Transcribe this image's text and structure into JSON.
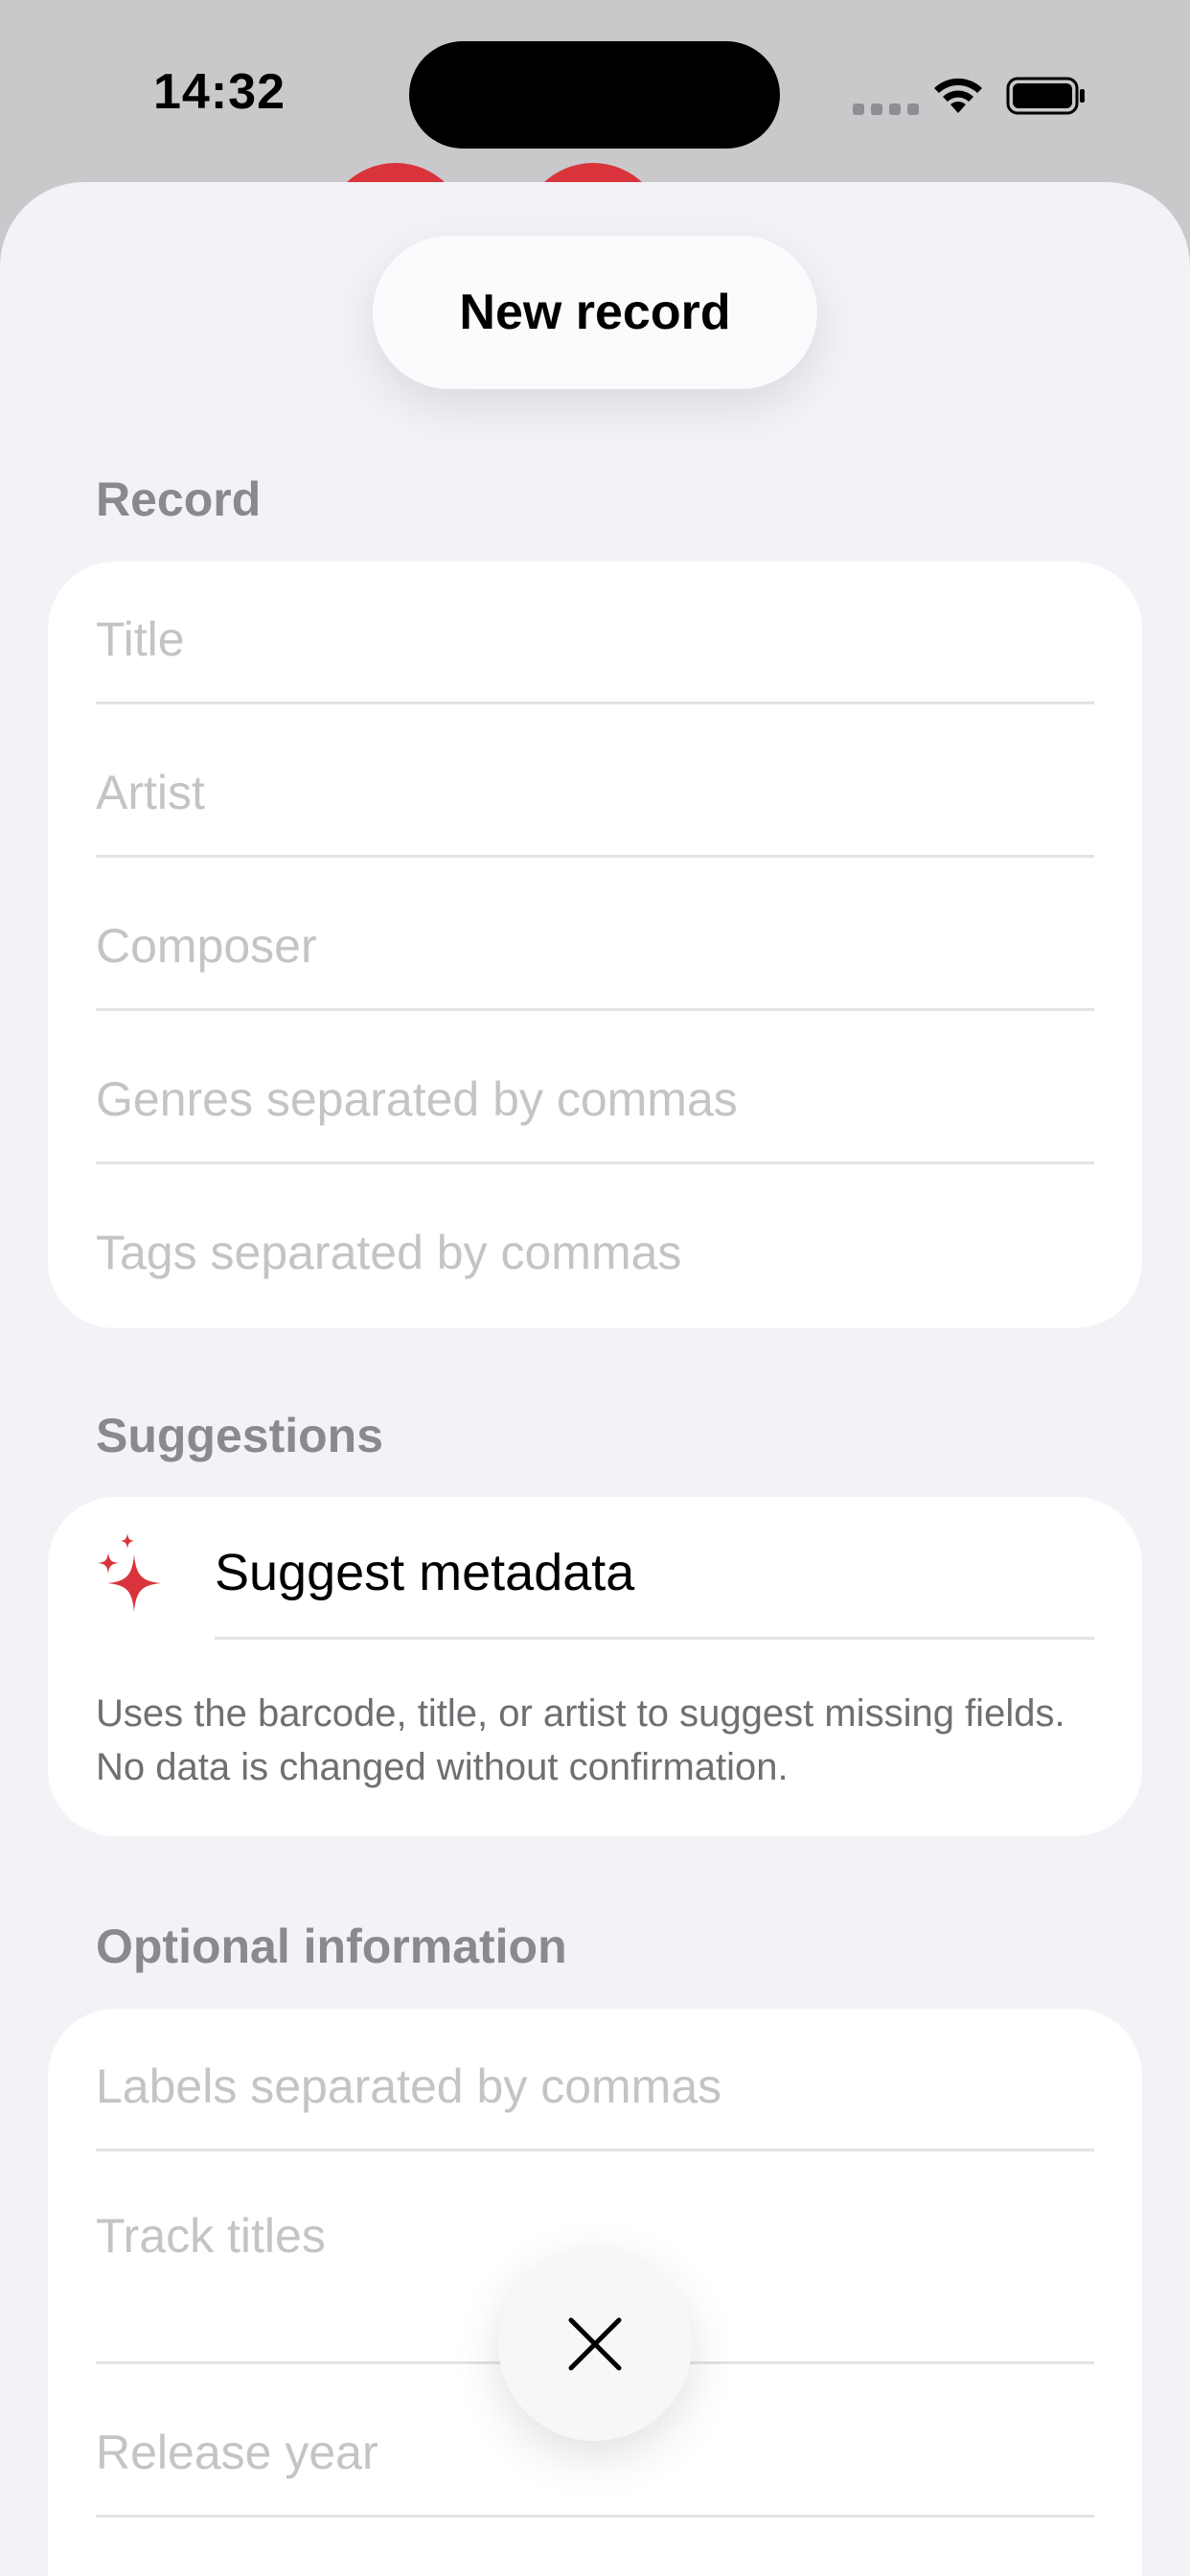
{
  "status_bar": {
    "time": "14:32"
  },
  "sheet": {
    "title": "New record"
  },
  "record_section": {
    "label": "Record",
    "fields": [
      {
        "placeholder": "Title"
      },
      {
        "placeholder": "Artist"
      },
      {
        "placeholder": "Composer"
      },
      {
        "placeholder": "Genres separated by commas"
      },
      {
        "placeholder": "Tags separated by commas"
      }
    ]
  },
  "suggestions_section": {
    "label": "Suggestions",
    "action_label": "Suggest metadata",
    "action_icon": "sparkles-icon",
    "description": "Uses the barcode, title, or artist to suggest missing fields. No data is changed without confirmation."
  },
  "optional_section": {
    "label": "Optional information",
    "fields": [
      {
        "placeholder": "Labels separated by commas"
      },
      {
        "placeholder": "Track titles"
      },
      {
        "placeholder": "Release year"
      }
    ]
  },
  "close_button": {
    "icon": "close-icon"
  },
  "colors": {
    "accent": "#d9343c",
    "sheet_background": "#f2f2f7",
    "card_background": "#ffffff",
    "placeholder": "#c4c4c7",
    "section_label": "#8a8a8e"
  }
}
